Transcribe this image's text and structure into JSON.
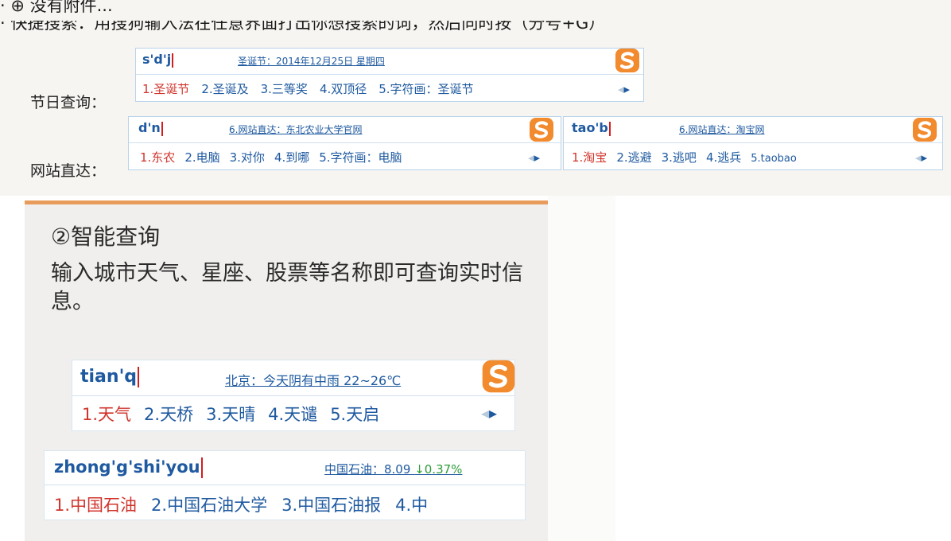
{
  "top_section": {
    "cut_line_1": "· ⊕ 没有附件...",
    "cut_line_2": "· 快捷搜索：用搜狗输入法在任意界面打出你想搜索的词，然后同时按（分号+G）",
    "labels": {
      "holiday": "节日查询：",
      "website": "网站直达："
    }
  },
  "ime_holiday": {
    "input": "s'd'j",
    "hint": "圣诞节：2014年12月25日 星期四",
    "candidates": [
      "1.圣诞节",
      "2.圣诞及",
      "3.三等奖",
      "4.双顶径",
      "5.字符画：圣诞节"
    ],
    "pager": {
      "prev": "◂",
      "next": "▸"
    }
  },
  "ime_website_1": {
    "input": "d'n",
    "hint": "6.网站直达：东北农业大学官网",
    "candidates": [
      "1.东农",
      "2.电脑",
      "3.对你",
      "4.到哪",
      "5.字符画：电脑"
    ],
    "pager": {
      "prev": "◂",
      "next": "▸"
    }
  },
  "ime_website_2": {
    "input": "tao'b",
    "hint": "6.网站直达：淘宝网",
    "candidates": [
      "1.淘宝",
      "2.逃避",
      "3.逃吧",
      "4.逃兵",
      "5.taobao"
    ],
    "pager": {
      "prev": "◂",
      "next": "▸"
    }
  },
  "slide": {
    "title": "②智能查询",
    "description": "输入城市天气、星座、股票等名称即可查询实时信息。"
  },
  "ime_weather": {
    "input": "tian'q",
    "hint": "北京：今天阴有中雨 22~26℃",
    "candidates": [
      "1.天气",
      "2.天桥",
      "3.天晴",
      "4.天谴",
      "5.天启"
    ],
    "pager": {
      "prev": "◂",
      "next": "▸"
    }
  },
  "ime_stock": {
    "input": "zhong'g'shi'you",
    "hint_label": "中国石油：8.09",
    "hint_change": "↓0.37%",
    "candidates": [
      "1.中国石油",
      "2.中国石油大学",
      "3.中国石油报",
      "4.中"
    ]
  },
  "colors": {
    "accent_orange": "#e89b5a",
    "candidate_blue": "#1f5aa0",
    "candidate_first_red": "#d0342c",
    "logo_orange": "#f28a2e"
  },
  "icons": {
    "ime_logo": "sogou-logo-icon"
  }
}
